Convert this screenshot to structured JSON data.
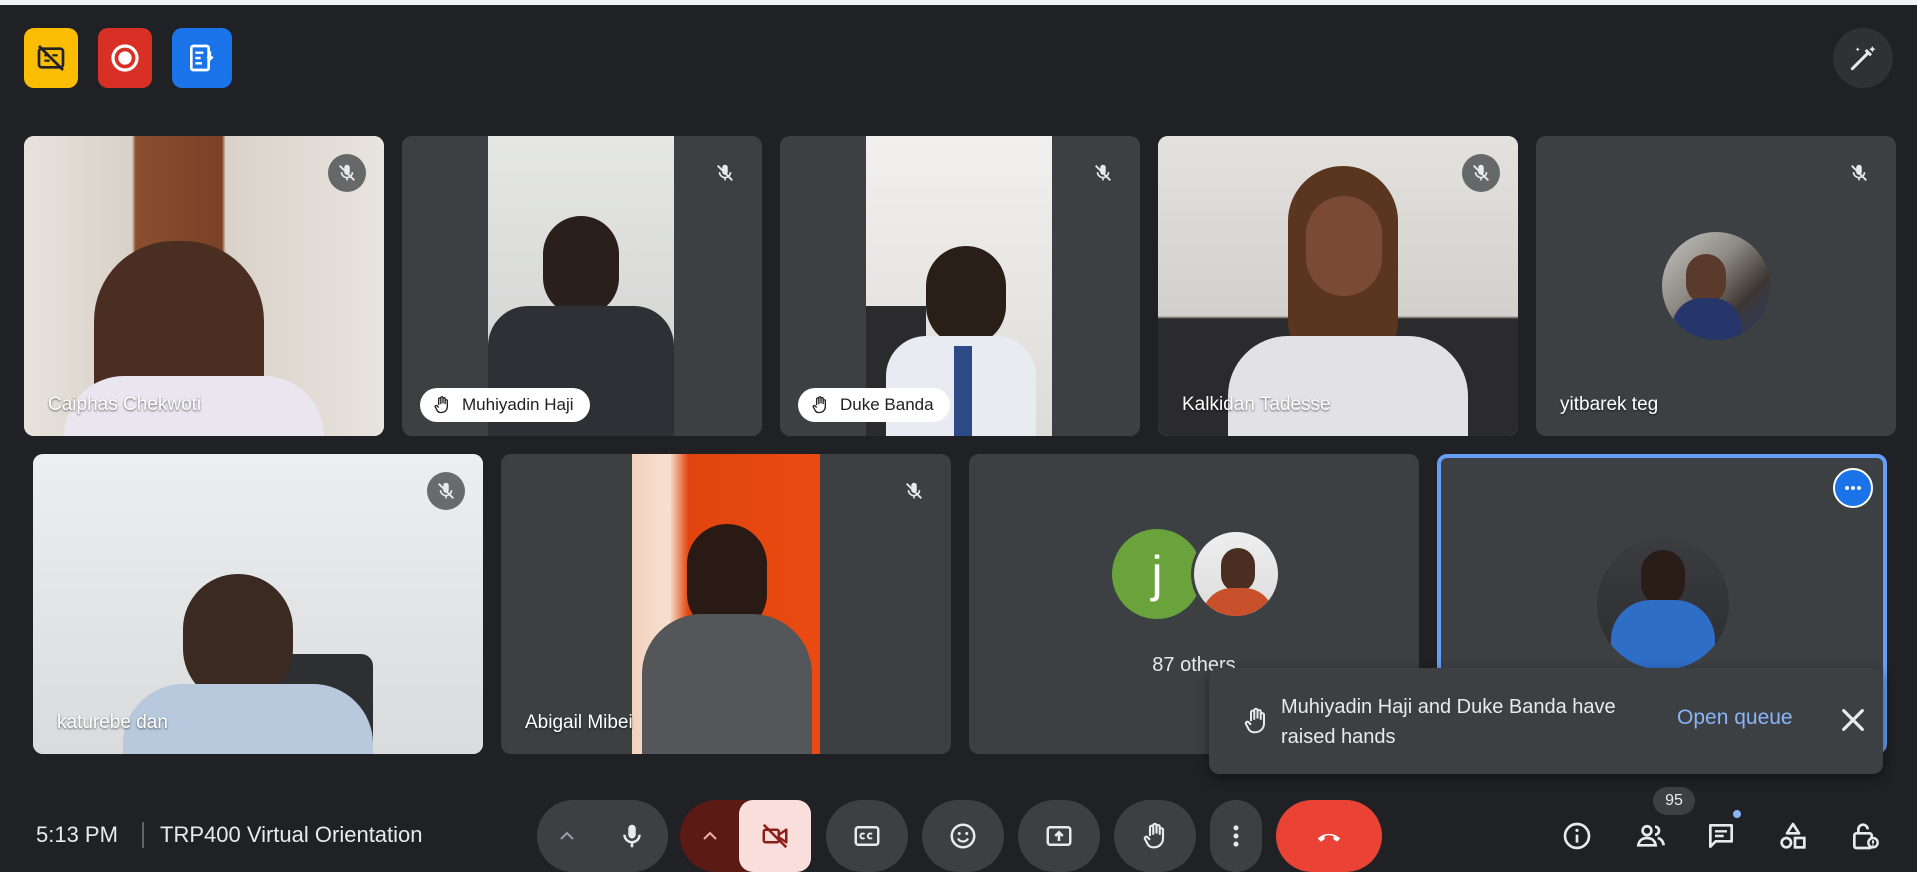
{
  "participants": [
    {
      "name": "Caiphas Chekwoti",
      "muted": true,
      "hand_raised": false
    },
    {
      "name": "Muhiyadin Haji",
      "muted": true,
      "hand_raised": true
    },
    {
      "name": "Duke Banda",
      "muted": true,
      "hand_raised": true
    },
    {
      "name": "Kalkidan Tadesse",
      "muted": true,
      "hand_raised": false
    },
    {
      "name": "yitbarek teg",
      "muted": true,
      "hand_raised": false
    },
    {
      "name": "katurebe dan",
      "muted": true,
      "hand_raised": false
    },
    {
      "name": "Abigail Mibei",
      "muted": true,
      "hand_raised": false
    }
  ],
  "others_tile": {
    "label": "87 others",
    "avatar_letter": "j"
  },
  "toast": {
    "message": "Muhiyadin Haji and Duke Banda have raised hands",
    "action": "Open queue"
  },
  "bottom_bar": {
    "time": "5:13 PM",
    "meeting_title": "TRP400 Virtual Orientation",
    "participant_count": "95"
  },
  "icons": {
    "top_badges": [
      "captions-off-icon",
      "recording-icon",
      "transcript-icon"
    ],
    "controls": [
      "chevron-up-icon",
      "microphone-icon",
      "chevron-up-icon",
      "camera-off-icon",
      "captions-icon",
      "emoji-icon",
      "present-screen-icon",
      "raise-hand-icon",
      "more-options-icon",
      "leave-call-icon"
    ],
    "right": [
      "info-icon",
      "people-icon",
      "chat-icon",
      "activities-icon",
      "host-controls-icon"
    ]
  },
  "colors": {
    "background": "#202124",
    "tile": "#3c4043",
    "accent_blue": "#8ab4f8",
    "leave_red": "#ea4335",
    "active_tile_border": "#669df6"
  }
}
